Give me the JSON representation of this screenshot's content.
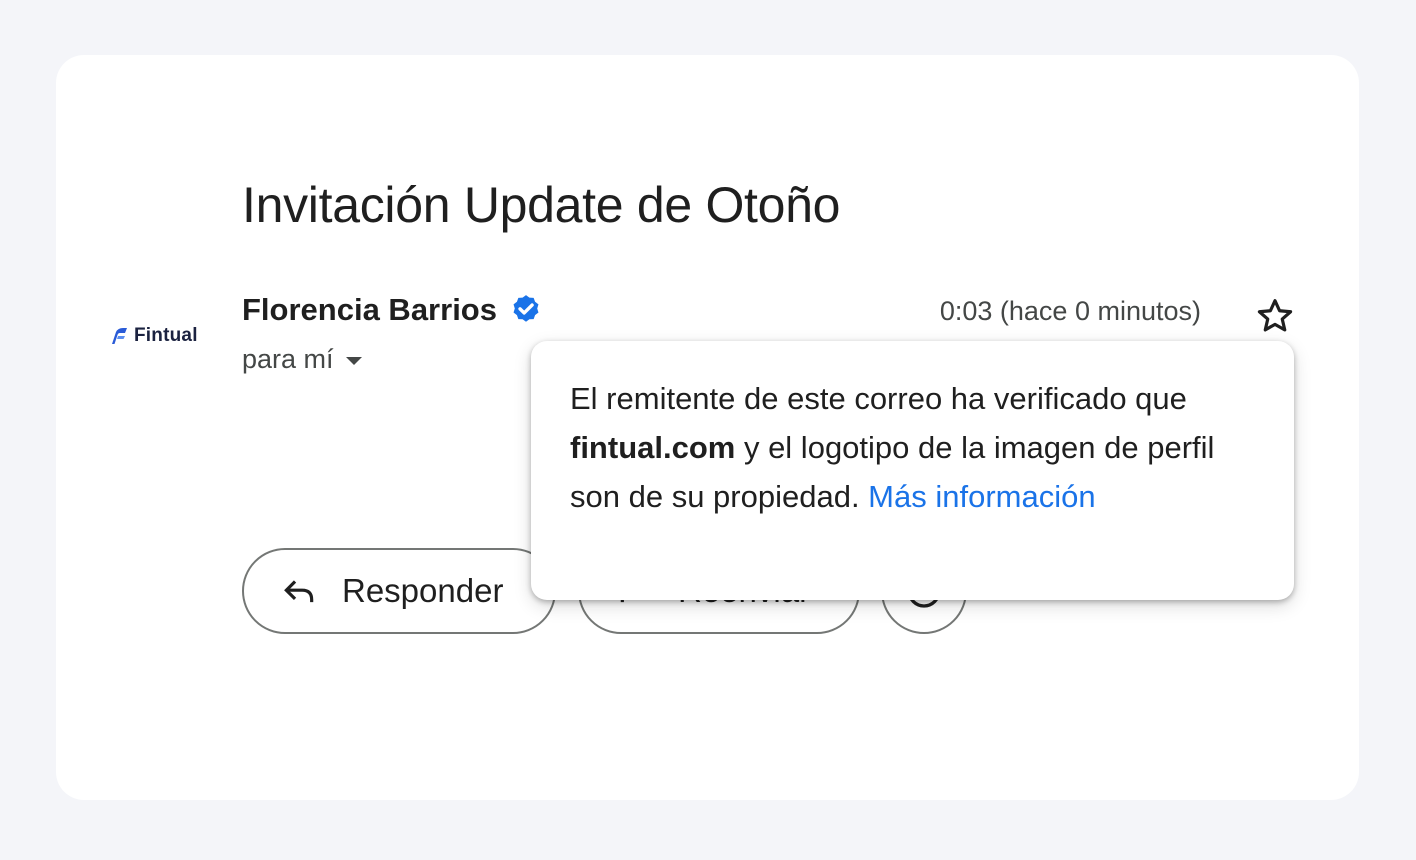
{
  "email": {
    "subject": "Invitación Update de Otoño",
    "sender_logo_text": "Fintual",
    "sender_name": "Florencia Barrios",
    "recipient": "para mí",
    "timestamp": "0:03 (hace 0 minutos)"
  },
  "actions": {
    "reply_label": "Responder",
    "forward_label": "Reenviar"
  },
  "tooltip": {
    "text_before": "El remitente de este correo ha verificado que ",
    "domain": "fintual.com",
    "text_after": " y el logotipo de la imagen de perfil son de su propiedad. ",
    "link": "Más información"
  },
  "icons": {
    "verified": "verified-badge-icon",
    "star": "star-icon",
    "reply": "reply-icon",
    "forward": "forward-icon",
    "emoji": "emoji-icon",
    "dropdown": "caret-down-icon"
  },
  "colors": {
    "accent_blue": "#1a73e8",
    "verified_blue": "#1a73e8",
    "brand_navy": "#1b2240",
    "brand_blue": "#2a5bd7"
  }
}
